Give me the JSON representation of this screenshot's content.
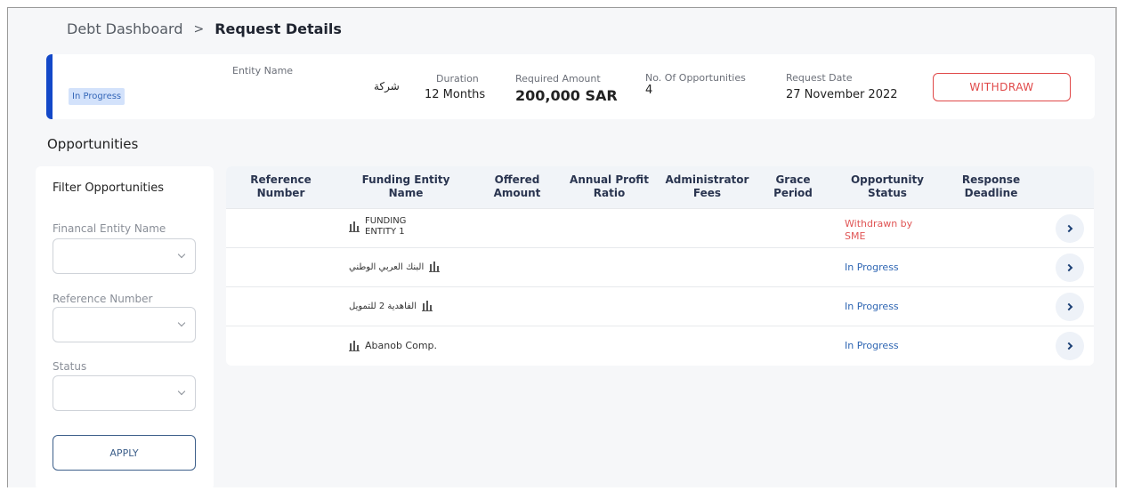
{
  "breadcrumb": {
    "parent": "Debt Dashboard",
    "separator": ">",
    "current": "Request Details"
  },
  "summary": {
    "status": "In Progress",
    "entity_name_label": "Entity Name",
    "entity_name_value": "شركة",
    "duration_label": "Duration",
    "duration_value": "12 Months",
    "required_amount_label": "Required Amount",
    "required_amount_value": "200,000 SAR",
    "opportunities_label": "No. Of Opportunities",
    "opportunities_value": "4",
    "request_date_label": "Request Date",
    "request_date_value": "27 November 2022",
    "withdraw_label": "WITHDRAW",
    "accent_color": "#1348c8"
  },
  "opportunities_title": "Opportunities",
  "filter": {
    "title": "Filter Opportunities",
    "fields": [
      {
        "label": "Financal Entity Name",
        "value": ""
      },
      {
        "label": "Reference Number",
        "value": ""
      },
      {
        "label": "Status",
        "value": ""
      }
    ],
    "apply_label": "APPLY"
  },
  "table": {
    "columns": [
      "Reference Number",
      "Funding Entity Name",
      "Offered Amount",
      "Annual Profit Ratio",
      "Administrator Fees",
      "Grace Period",
      "Opportunity Status",
      "Response Deadline"
    ],
    "rows": [
      {
        "entity": "FUNDING ENTITY 1",
        "status": "Withdrawn by SME",
        "status_color": "#e05555"
      },
      {
        "entity": "البنك العربي الوطني",
        "status": "In Progress",
        "status_color": "#2f66b3"
      },
      {
        "entity": "الفاهدية 2 للتمويل",
        "status": "In Progress",
        "status_color": "#2f66b3"
      },
      {
        "entity": "Abanob Comp.",
        "status": "In Progress",
        "status_color": "#2f66b3"
      }
    ]
  }
}
